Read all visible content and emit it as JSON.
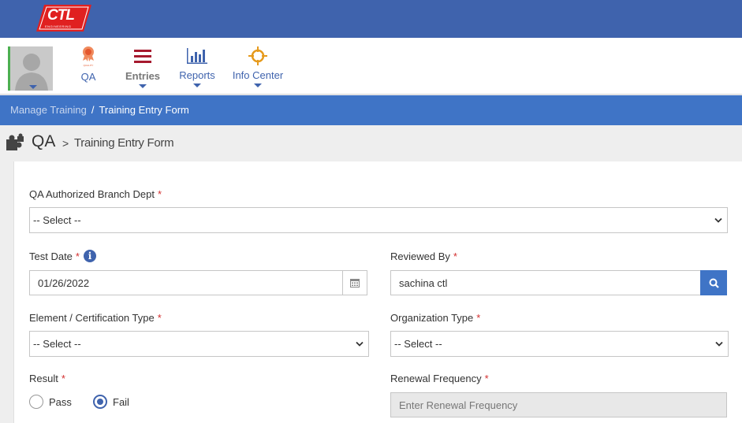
{
  "logo": {
    "text": "CTL",
    "subtext": "ENGINEERING"
  },
  "nav": {
    "qa_badge": "QUALITY",
    "items": [
      {
        "label": "QA",
        "icon": "quality-medal-icon"
      },
      {
        "label": "Entries",
        "icon": "hamburger-list-icon"
      },
      {
        "label": "Reports",
        "icon": "bar-chart-icon"
      },
      {
        "label": "Info Center",
        "icon": "crosshair-icon"
      }
    ]
  },
  "breadcrumb": {
    "parent": "Manage Training",
    "separator": "/",
    "current": "Training Entry Form"
  },
  "title": {
    "main": "QA",
    "separator": ">",
    "sub": "Training Entry Form"
  },
  "form": {
    "branch_dept": {
      "label": "QA Authorized Branch Dept",
      "required": "*",
      "value": "-- Select --"
    },
    "test_date": {
      "label": "Test Date",
      "required": "*",
      "value": "01/26/2022"
    },
    "reviewed_by": {
      "label": "Reviewed By",
      "required": "*",
      "value": "sachina ctl"
    },
    "element_type": {
      "label": "Element / Certification Type",
      "required": "*",
      "value": "-- Select --"
    },
    "org_type": {
      "label": "Organization Type",
      "required": "*",
      "value": "-- Select --"
    },
    "result": {
      "label": "Result",
      "required": "*",
      "options": [
        "Pass",
        "Fail"
      ],
      "selected": "Fail"
    },
    "renewal": {
      "label": "Renewal Frequency",
      "required": "*",
      "placeholder": "Enter Renewal Frequency"
    }
  },
  "colors": {
    "header": "#3f63ad",
    "breadcrumb": "#3f74c6",
    "entries": "#a6192e",
    "info_center": "#e69a1c",
    "required": "#d32f2f"
  }
}
